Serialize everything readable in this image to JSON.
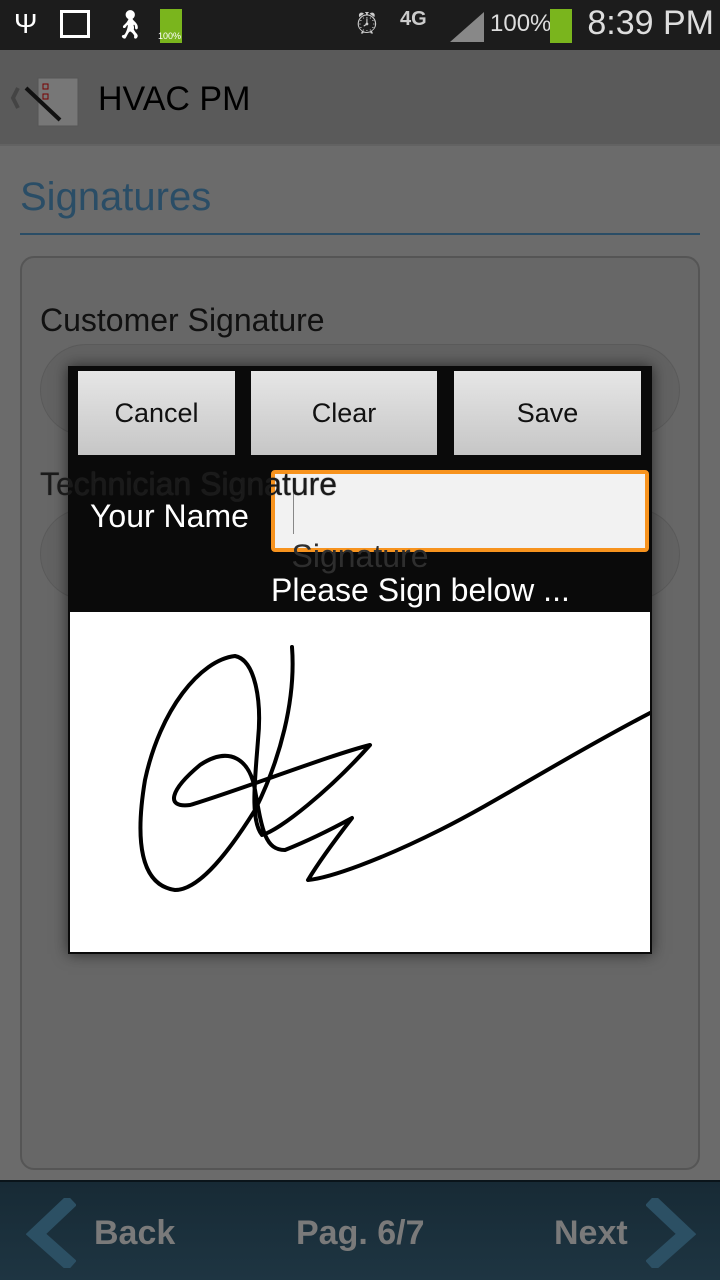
{
  "status_bar": {
    "icons": [
      "usb-icon",
      "image-icon",
      "walking-icon",
      "battery-icon",
      "alarm-icon",
      "4g-lte-icon",
      "signal-icon",
      "battery-icon"
    ],
    "battery_small": "100%",
    "battery": "100%",
    "time": "8:39 PM",
    "battery_color": "#7ab51d"
  },
  "action_bar": {
    "title": "HVAC PM"
  },
  "page": {
    "title": "Signatures",
    "customer_label": "Customer Signature",
    "technician_label": "Technician Signature",
    "technician_button": "Signature",
    "accent": "#3b7aa8"
  },
  "nav": {
    "back": "Back",
    "page": "Pag. 6/7",
    "next": "Next"
  },
  "dialog": {
    "cancel": "Cancel",
    "clear": "Clear",
    "save": "Save",
    "name_label": "Your Name",
    "name_value": "",
    "hint": "Please Sign below ...",
    "focus_color": "#f7931e"
  }
}
